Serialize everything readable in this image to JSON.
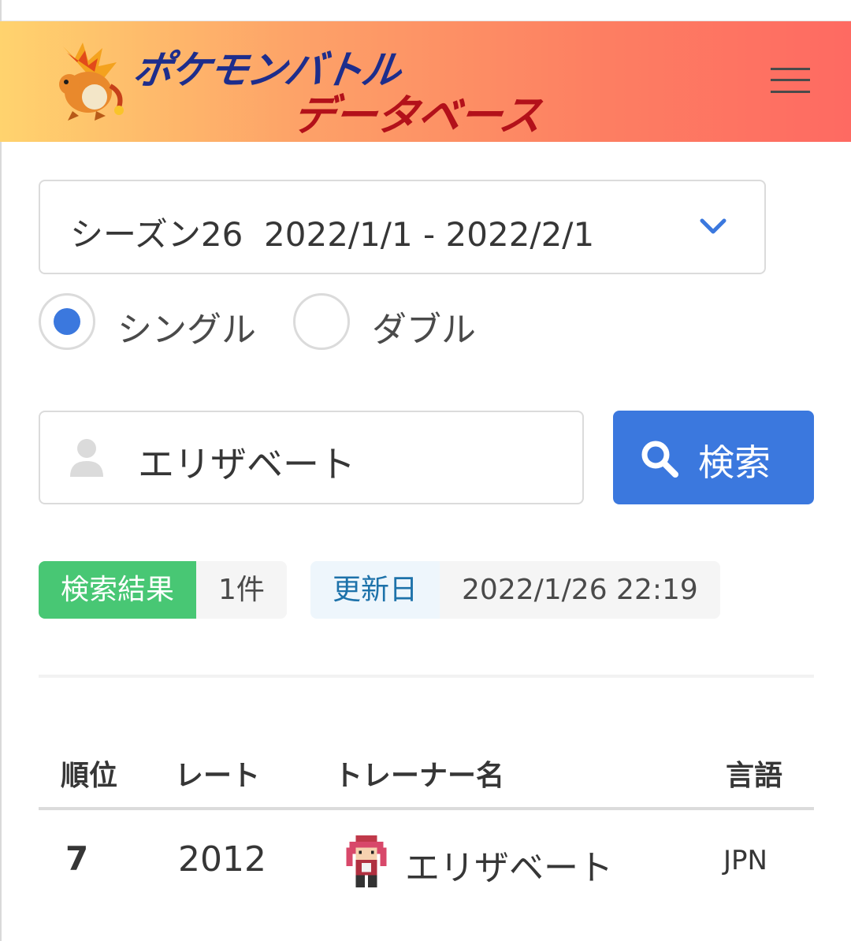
{
  "header": {
    "logo_line1": "ポケモンバトル",
    "logo_line2": "データベース",
    "mascot_icon": "charizard-mascot-icon",
    "menu_icon": "hamburger-menu-icon"
  },
  "season_select": {
    "value": "シーズン26  2022/1/1 - 2022/2/1",
    "arrow_icon": "chevron-down-icon"
  },
  "battle_mode": {
    "options": [
      {
        "label": "シングル",
        "selected": true
      },
      {
        "label": "ダブル",
        "selected": false
      }
    ]
  },
  "search": {
    "value": "エリザベート",
    "user_icon": "user-icon",
    "button_label": "検索",
    "button_icon": "search-icon"
  },
  "tags": {
    "results_label": "検索結果",
    "results_count": "1件",
    "updated_label": "更新日",
    "updated_value": "2022/1/26 22:19"
  },
  "table": {
    "headers": [
      "順位",
      "レート",
      "トレーナー名",
      "言語"
    ],
    "rows": [
      {
        "rank": "7",
        "rate": "2012",
        "trainer": "エリザベート",
        "trainer_icon": "trainer-sprite-icon",
        "lang": "JPN"
      }
    ]
  },
  "colors": {
    "primary": "#3b78de",
    "success": "#48c774",
    "info_text": "#1d72aa",
    "header_gradient": [
      "#ffd36e",
      "#fe6a62"
    ]
  }
}
